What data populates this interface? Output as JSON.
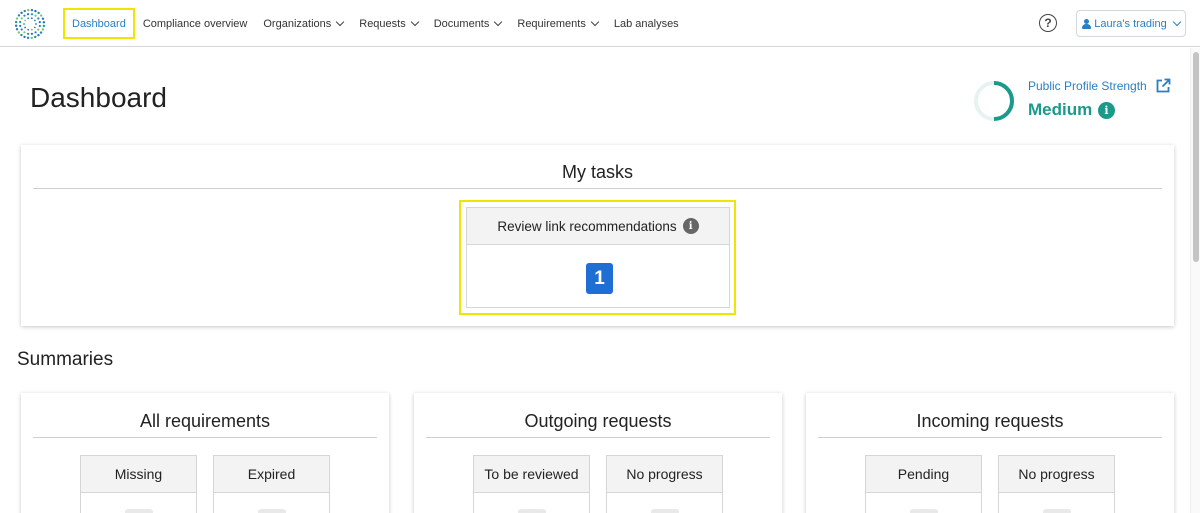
{
  "nav": {
    "items": [
      {
        "label": "Dashboard",
        "has_caret": false,
        "active": true
      },
      {
        "label": "Compliance overview",
        "has_caret": false,
        "active": false
      },
      {
        "label": "Organizations",
        "has_caret": true,
        "active": false
      },
      {
        "label": "Requests",
        "has_caret": true,
        "active": false
      },
      {
        "label": "Documents",
        "has_caret": true,
        "active": false
      },
      {
        "label": "Requirements",
        "has_caret": true,
        "active": false
      },
      {
        "label": "Lab analyses",
        "has_caret": false,
        "active": false
      }
    ],
    "help_icon": "question-circle-icon",
    "account_label": "Laura's trading"
  },
  "header": {
    "title": "Dashboard",
    "profile_strength_label": "Public Profile Strength",
    "profile_strength_level": "Medium",
    "profile_strength_fraction": 0.5,
    "accent_color": "#1a9a8a",
    "link_color": "#2a7fc2"
  },
  "tasks": {
    "title": "My tasks",
    "items": [
      {
        "label": "Review link recommendations",
        "count": "1"
      }
    ]
  },
  "summaries": {
    "title": "Summaries",
    "cards": [
      {
        "title": "All requirements",
        "stats": [
          {
            "label": "Missing"
          },
          {
            "label": "Expired"
          }
        ]
      },
      {
        "title": "Outgoing requests",
        "stats": [
          {
            "label": "To be reviewed"
          },
          {
            "label": "No progress"
          }
        ]
      },
      {
        "title": "Incoming requests",
        "stats": [
          {
            "label": "Pending"
          },
          {
            "label": "No progress"
          }
        ]
      }
    ]
  }
}
